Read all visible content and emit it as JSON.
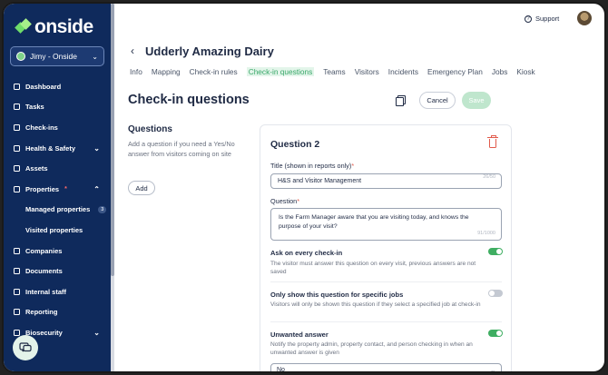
{
  "app": {
    "brand": "onside",
    "user_selector": "Jimy - Onside",
    "support_label": "Support"
  },
  "sidebar": {
    "items": [
      {
        "label": "Dashboard",
        "icon": "grid-icon"
      },
      {
        "label": "Tasks",
        "icon": "checklist-icon"
      },
      {
        "label": "Check-ins",
        "icon": "checkin-icon"
      },
      {
        "label": "Health & Safety",
        "icon": "shield-icon",
        "expandable": true
      },
      {
        "label": "Assets",
        "icon": "assets-icon"
      },
      {
        "label": "Properties",
        "icon": "map-pin-icon",
        "expandable": true,
        "expanded": true,
        "alert": "*"
      },
      {
        "label": "Managed properties",
        "sub": true,
        "count": "3"
      },
      {
        "label": "Visited properties",
        "sub": true
      },
      {
        "label": "Companies",
        "icon": "building-icon"
      },
      {
        "label": "Documents",
        "icon": "document-icon"
      },
      {
        "label": "Internal staff",
        "icon": "staff-icon"
      },
      {
        "label": "Reporting",
        "icon": "report-icon"
      },
      {
        "label": "Biosecurity",
        "icon": "biosecurity-icon",
        "expandable": true
      }
    ]
  },
  "header": {
    "title": "Udderly Amazing Dairy",
    "tabs": [
      "Info",
      "Mapping",
      "Check-in rules",
      "Check-in questions",
      "Teams",
      "Visitors",
      "Incidents",
      "Emergency Plan",
      "Jobs",
      "Kiosk"
    ],
    "active_tab": "Check-in questions"
  },
  "section": {
    "title": "Check-in questions",
    "cancel_label": "Cancel",
    "save_label": "Save"
  },
  "left": {
    "title": "Questions",
    "description": "Add a question if you need a Yes/No answer from visitors coming on site",
    "add_label": "Add"
  },
  "question": {
    "heading": "Question 2",
    "title_label": "Title (shown in reports only)",
    "title_value": "H&S and Visitor Management",
    "title_count": "26/50",
    "question_label": "Question",
    "question_value": "Is the Farm Manager aware that you are visiting today, and knows the purpose of your visit?",
    "question_count": "91/1000",
    "options": [
      {
        "title": "Ask on every check-in",
        "desc": "The visitor must answer this question on every visit, previous answers are not saved",
        "on": true
      },
      {
        "title": "Only show this question for specific jobs",
        "desc": "Visitors will only be shown this question if they select a specified job at check-in",
        "on": false
      },
      {
        "title": "Unwanted answer",
        "desc": "Notify the property admin, property contact, and person checking in when an unwanted answer is given",
        "on": true
      }
    ],
    "unwanted_value": "No"
  },
  "colors": {
    "sidebar": "#0f2a5c",
    "accent": "#3fae62",
    "danger": "#e15a4b"
  }
}
